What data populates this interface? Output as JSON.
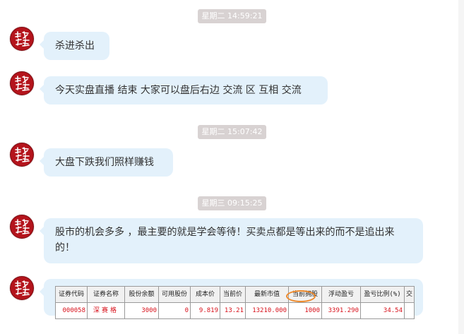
{
  "timestamps": [
    "星期二 14:59:21",
    "星期二 15:07:42",
    "星期三 09:15:25"
  ],
  "messages": [
    "杀进杀出",
    "今天实盘直播 结束 大家可以盘后右边 交流 区 互相 交流",
    "大盘下跌我们照样赚钱",
    "股市的机会多多 ，最主要的就是学会等待！买卖点都是等出来的而不是追出来的！"
  ],
  "avatar": {
    "icon": "seal-logo-icon",
    "color": "#b4141c"
  },
  "colors": {
    "bubble": "#e3f1fb",
    "timestamp_bg": "#d8d2d2",
    "table_value": "#d8101a",
    "highlight_ring": "#ee8a2c"
  },
  "holdings_table": {
    "headers": [
      "证券代码",
      "证券名称",
      "股份余额",
      "可用股份",
      "成本价",
      "当前价",
      "最新市值",
      "当前拥股",
      "浮动盈亏",
      "盈亏比例(%)",
      "交"
    ],
    "row": [
      "000058",
      "深赛格",
      "3000",
      "0",
      "9.819",
      "13.21",
      "13210.000",
      "1000",
      "3391.290",
      "34.54",
      ""
    ]
  }
}
